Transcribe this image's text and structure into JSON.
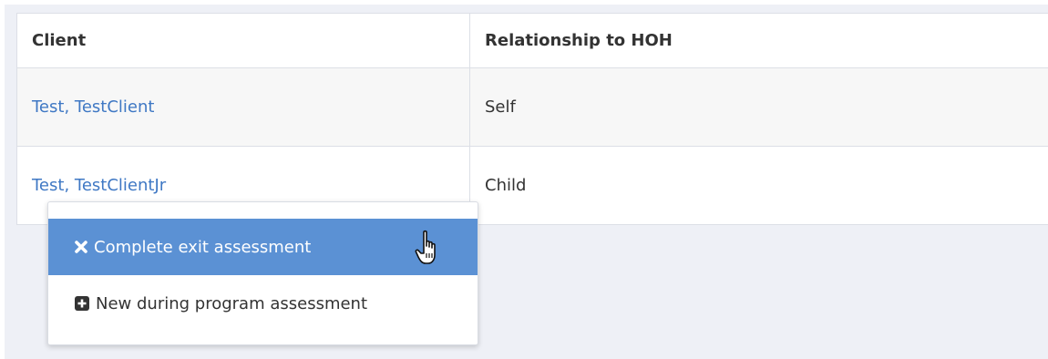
{
  "table": {
    "headers": [
      "Client",
      "Relationship to HOH"
    ],
    "rows": [
      {
        "client": "Test, TestClient",
        "relationship": "Self"
      },
      {
        "client": "Test, TestClientJr",
        "relationship": "Child"
      }
    ]
  },
  "context_menu": {
    "items": [
      {
        "label": "Complete exit assessment",
        "icon": "x-icon"
      },
      {
        "label": "New during program assessment",
        "icon": "plus-square-icon"
      }
    ]
  },
  "colors": {
    "link": "#3f78c4",
    "menu_highlight": "#5b91d4",
    "panel_bg": "#eef0f6"
  }
}
